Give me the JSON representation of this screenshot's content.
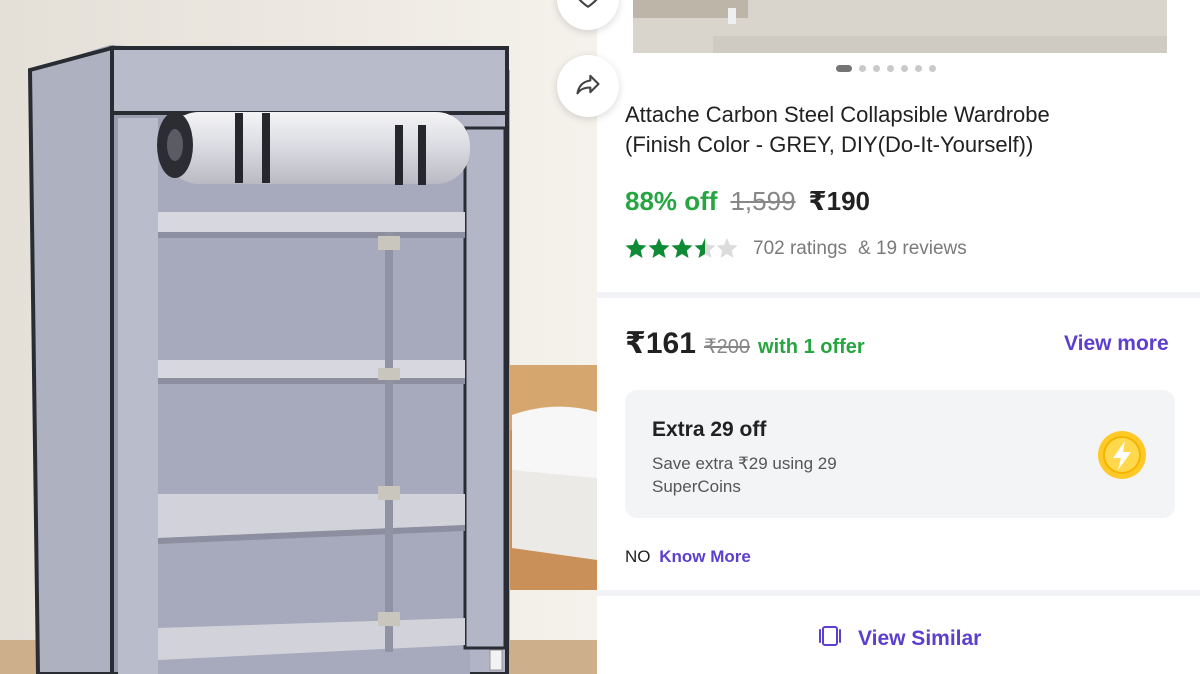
{
  "product": {
    "title_line1": "Attache Carbon Steel Collapsible Wardrobe",
    "title_line2": "(Finish Color - GREY, DIY(Do-It-Yourself))",
    "discount": "88% off",
    "mrp": "1,599",
    "price": "₹190",
    "rating_stars": 3.5,
    "ratings": "702 ratings",
    "reviews": "& 19 reviews"
  },
  "gallery": {
    "dot_count": 7,
    "active_index": 0,
    "icons": [
      "heart-icon",
      "share-icon"
    ]
  },
  "offer": {
    "price": "₹161",
    "mrp": "₹200",
    "text": "with 1 offer",
    "view_more": "View more"
  },
  "supercoins": {
    "title": "Extra 29 off",
    "subtitle": "Save extra ₹29 using 29 SuperCoins",
    "icon": "lightning-coin-icon"
  },
  "know": {
    "prefix": "NO",
    "link": "Know More"
  },
  "similar": {
    "label": "View Similar",
    "icon": "similar-icon"
  },
  "colors": {
    "green": "#26a541",
    "purple": "#5b3fce",
    "coin_yellow": "#ffc928"
  }
}
